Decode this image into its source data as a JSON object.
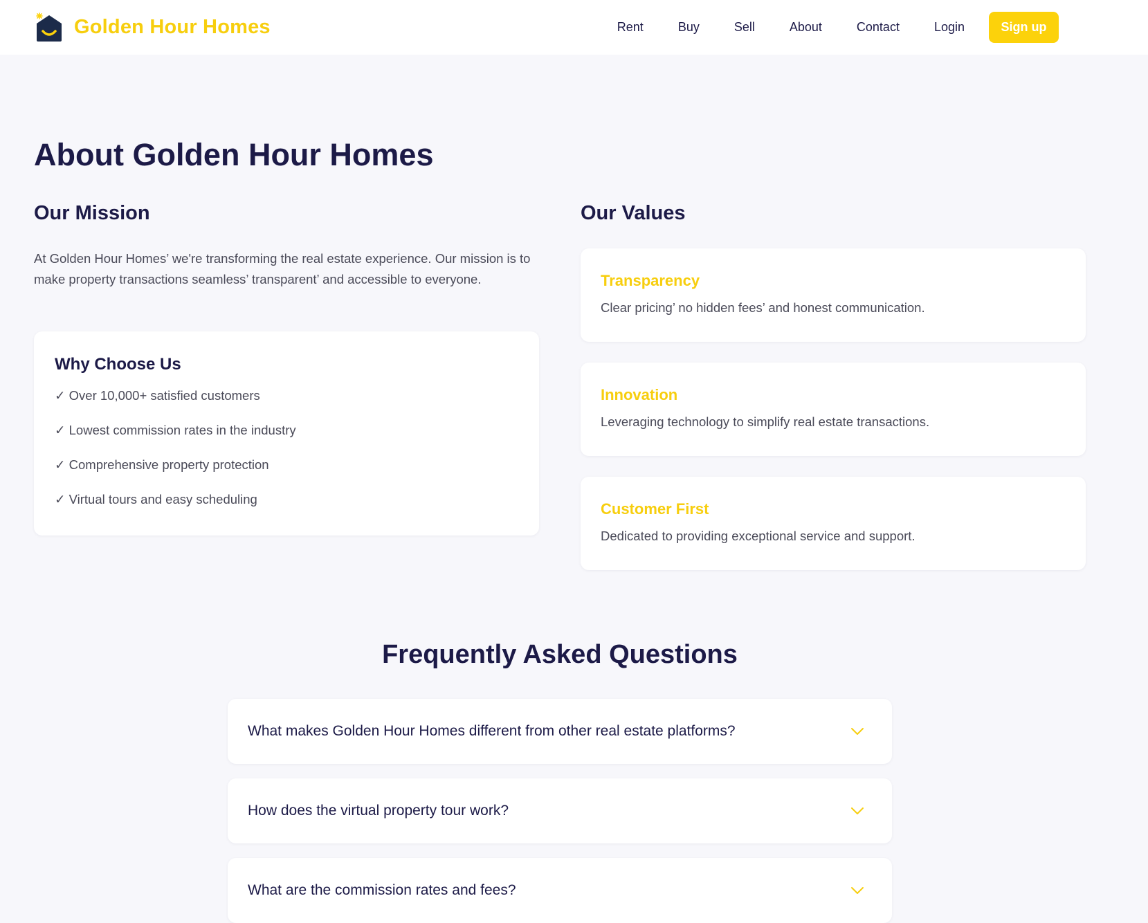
{
  "brand": {
    "name": "Golden Hour Homes",
    "accent": "#f7ce0e",
    "logo_icon": "house-smile-icon"
  },
  "nav": {
    "links": [
      "Rent",
      "Buy",
      "Sell",
      "About",
      "Contact",
      "Login"
    ],
    "signup": "Sign up"
  },
  "page": {
    "title": "About Golden Hour Homes"
  },
  "mission": {
    "heading": "Our Mission",
    "text": "At Golden Hour Homes’ we're transforming the real estate experience. Our mission is to make property transactions seamless’ transparent’ and accessible to everyone."
  },
  "why": {
    "title": "Why Choose Us",
    "items": [
      "✓ Over 10,000+ satisfied customers",
      "✓ Lowest commission rates in the industry",
      "✓ Comprehensive property protection",
      "✓ Virtual tours and easy scheduling"
    ]
  },
  "values": {
    "heading": "Our Values",
    "items": [
      {
        "title": "Transparency",
        "desc": "Clear pricing’ no hidden fees’ and honest communication."
      },
      {
        "title": "Innovation",
        "desc": "Leveraging technology to simplify real estate transactions."
      },
      {
        "title": "Customer First",
        "desc": "Dedicated to providing exceptional service and support."
      }
    ]
  },
  "faq": {
    "title": "Frequently Asked Questions",
    "items": [
      "What makes Golden Hour Homes different from other real estate platforms?",
      "How does the virtual property tour work?",
      "What are the commission rates and fees?"
    ],
    "chevron_icon": "chevron-down-icon"
  }
}
